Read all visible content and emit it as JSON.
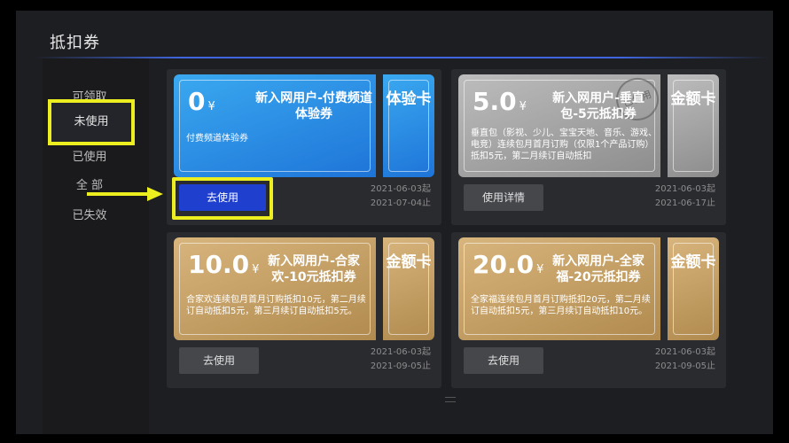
{
  "page_title": "抵扣券",
  "sidebar": {
    "items": [
      {
        "label": "可领取"
      },
      {
        "label": "未使用"
      },
      {
        "label": "已使用"
      },
      {
        "label": "全 部"
      },
      {
        "label": "已失效"
      }
    ]
  },
  "coupons": [
    {
      "amount": "0",
      "unit": "¥",
      "headline": "新入网用户-付费频道体验券",
      "description": "付费频道体验券",
      "stub": "体验卡",
      "button": "去使用",
      "start": "2021-06-03起",
      "end": "2021-07-04止",
      "theme": "#2f8de6"
    },
    {
      "amount": "5.0",
      "unit": "¥",
      "headline": "新入网用户-垂直包-5元抵扣券",
      "description": "垂直包（影视、少儿、宝宝天地、音乐、游戏、电竞）连续包月首月订购（仅限1个产品订购）抵扣5元，第二月续订自动抵扣",
      "stub": "金额卡",
      "stamp": "已使用",
      "button": "使用详情",
      "start": "2021-06-03起",
      "end": "2021-06-17止",
      "theme": "#a9a9a9"
    },
    {
      "amount": "10.0",
      "unit": "¥",
      "headline": "新入网用户-合家欢-10元抵扣券",
      "description": "合家欢连续包月首月订购抵扣10元，第二月续订自动抵扣5元，第三月续订自动抵扣5元。",
      "stub": "金额卡",
      "button": "去使用",
      "start": "2021-06-03起",
      "end": "2021-09-05止",
      "theme": "#c9a367"
    },
    {
      "amount": "20.0",
      "unit": "¥",
      "headline": "新入网用户-全家福-20元抵扣券",
      "description": "全家福连续包月首月订购抵扣20元，第二月续订自动抵扣5元，第三月续订自动抵扣10元。",
      "stub": "金额卡",
      "button": "去使用",
      "start": "2021-06-03起",
      "end": "2021-09-05止",
      "theme": "#c9a367"
    }
  ],
  "colors": {
    "highlight": "#ecee1f",
    "active_button": "#1f3fcf",
    "title_rule": "#3f66de"
  }
}
